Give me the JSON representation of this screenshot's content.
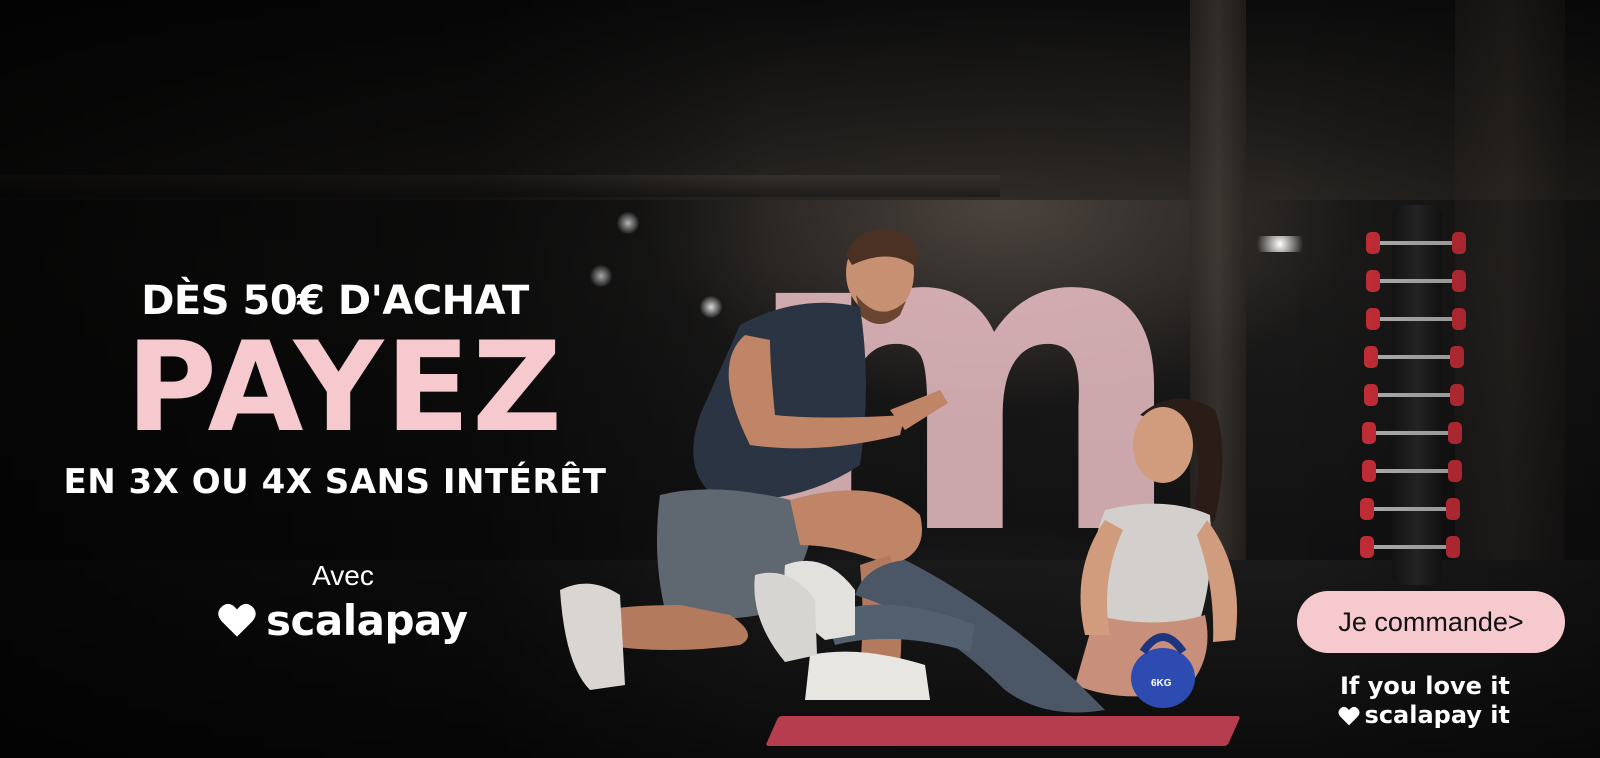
{
  "banner": {
    "brand_letter": "m",
    "headline_pre": "DÈS 50€ D'ACHAT",
    "headline_main": "PAYEZ",
    "headline_sub": "EN 3X OU 4X SANS INTÉRÊT",
    "avec": "Avec",
    "scalapay_word": "scalapay",
    "cta_label": "Je commande>",
    "tagline_line1": "If you love it",
    "tagline_line2": "scalapay it",
    "kettlebell_label": "6KG"
  },
  "icons": {
    "logo_heart": "heart-icon",
    "tagline_heart": "heart-icon"
  },
  "colors": {
    "accent_pink": "#f6c9cf",
    "text_white": "#ffffff",
    "mat_red": "#c94355",
    "dumbbell_red": "#d2303b",
    "kettlebell_blue": "#2d4bb0"
  }
}
